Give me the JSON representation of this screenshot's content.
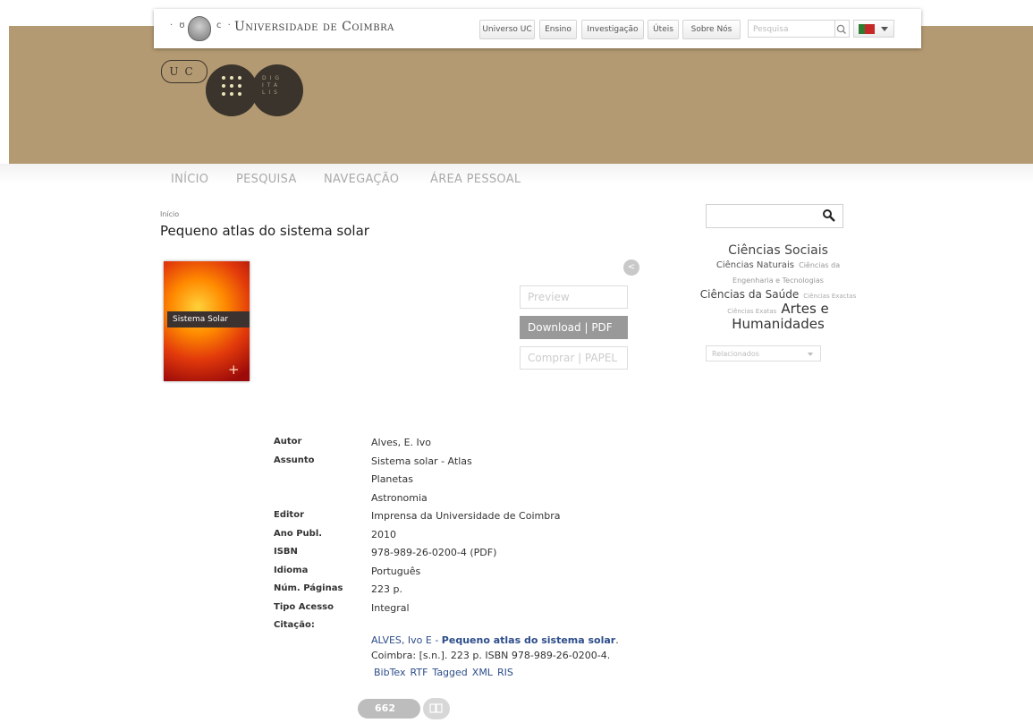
{
  "topbar": {
    "crest_left": "· ʊ",
    "crest_right": "ϲ ·",
    "title": "Universidade de Coimbra",
    "buttons": [
      "Universo UC",
      "Ensino",
      "Investigação",
      "Úteis",
      "Sobre Nós"
    ],
    "search_placeholder": "Pesquisa",
    "search_icon": "search-icon",
    "language_flag": "portugal-flag-icon"
  },
  "logo": {
    "uc": "UC",
    "digitalis": "DIG ITA LIS"
  },
  "nav": {
    "items": [
      "INÍCIO",
      "PESQUISA",
      "NAVEGAÇÃO",
      "ÁREA PESSOAL"
    ]
  },
  "breadcrumb": "Início",
  "page_title": "Pequeno atlas do sistema solar",
  "cover": {
    "band_text": "Sistema Solar"
  },
  "actions": {
    "preview": "Preview",
    "download": "Download | PDF",
    "buy": "Comprar | PAPEL"
  },
  "sidebar": {
    "search_icon": "search-icon",
    "cloud": {
      "t1": "Ciências Sociais",
      "t2": "Ciências Naturais",
      "t3": "Ciências da Engenharia e Tecnologias",
      "t4": "Ciências da Saúde",
      "t5": "Ciências Exactas",
      "t6": "Ciências Exatas",
      "t7": "Artes e Humanidades"
    },
    "related": "Relacionados"
  },
  "metadata": {
    "autor_label": "Autor",
    "autor": "Alves, E. Ivo",
    "assunto_label": "Assunto",
    "assunto1": "Sistema solar - Atlas",
    "assunto2": "Planetas",
    "assunto3": "Astronomia",
    "editor_label": "Editor",
    "editor": "Imprensa da Universidade de Coimbra",
    "ano_label": "Ano Publ.",
    "ano": "2010",
    "isbn_label": "ISBN",
    "isbn": "978-989-26-0200-4 (PDF)",
    "idioma_label": "Idioma",
    "idioma": "Português",
    "paginas_label": "Núm. Páginas",
    "paginas": "223 p.",
    "tipo_label": "Tipo Acesso",
    "tipo": "Integral",
    "citacao_label": "Citação:"
  },
  "citation": {
    "author": "ALVES, Ivo E - ",
    "title": "Pequeno atlas do sistema solar",
    "rest": ". Coimbra: [s.n.]. 223 p. ISBN 978-989-26-0200-4."
  },
  "exports": [
    "BibTex",
    "RTF",
    "Tagged",
    "XML",
    "RIS"
  ],
  "views": "662"
}
